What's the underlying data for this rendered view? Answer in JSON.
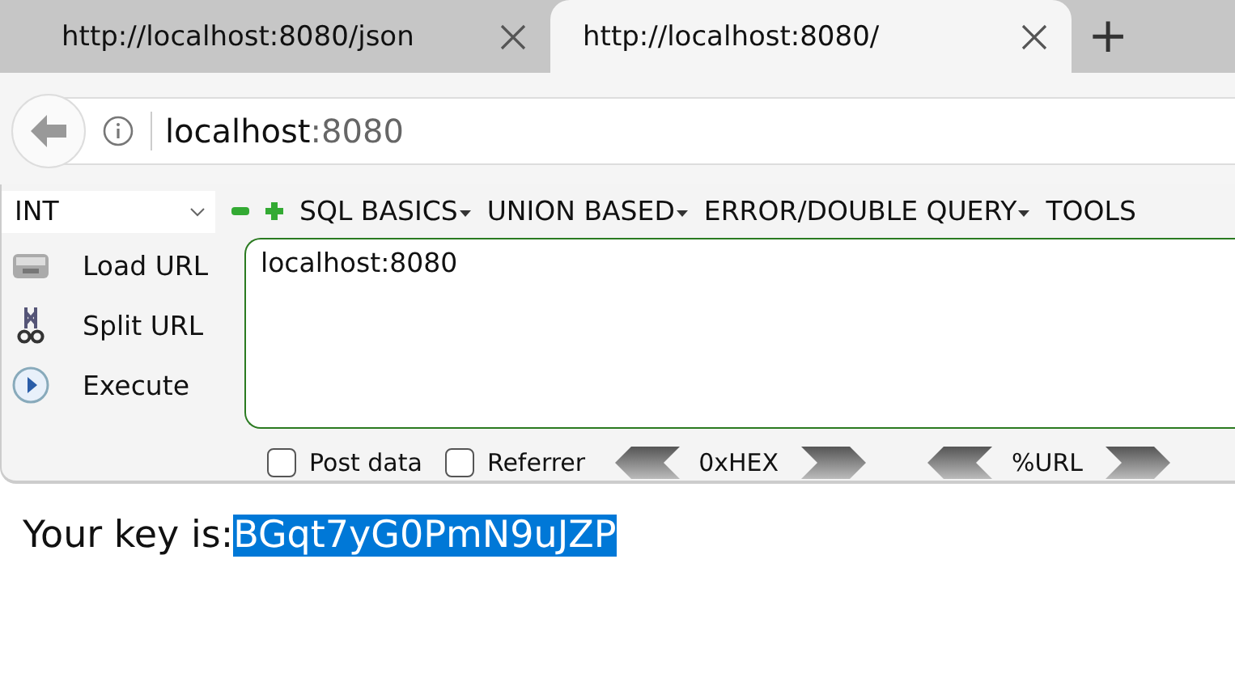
{
  "tabs": [
    {
      "title": "http://localhost:8080/json",
      "selected": false
    },
    {
      "title": "http://localhost:8080/",
      "selected": true
    }
  ],
  "new_tab": "+",
  "address": {
    "host": "localhost",
    "port": ":8080"
  },
  "hackbar": {
    "select": "INT",
    "menus": [
      "SQL BASICS",
      "UNION BASED",
      "ERROR/DOUBLE QUERY",
      "TOOLS"
    ],
    "actions": [
      {
        "kind": "load",
        "label": "Load URL"
      },
      {
        "kind": "split",
        "label": "Split URL"
      },
      {
        "kind": "execute",
        "label": "Execute"
      }
    ],
    "url_value": "localhost:8080",
    "options": [
      {
        "label": "Post data",
        "checked": false
      },
      {
        "label": "Referrer",
        "checked": false
      }
    ],
    "encoders": [
      "0xHEX",
      "%URL"
    ]
  },
  "page": {
    "label": "Your key is:",
    "key": {
      "text": "BGqt7yG0PmN9uJZP",
      "selected": true
    }
  }
}
